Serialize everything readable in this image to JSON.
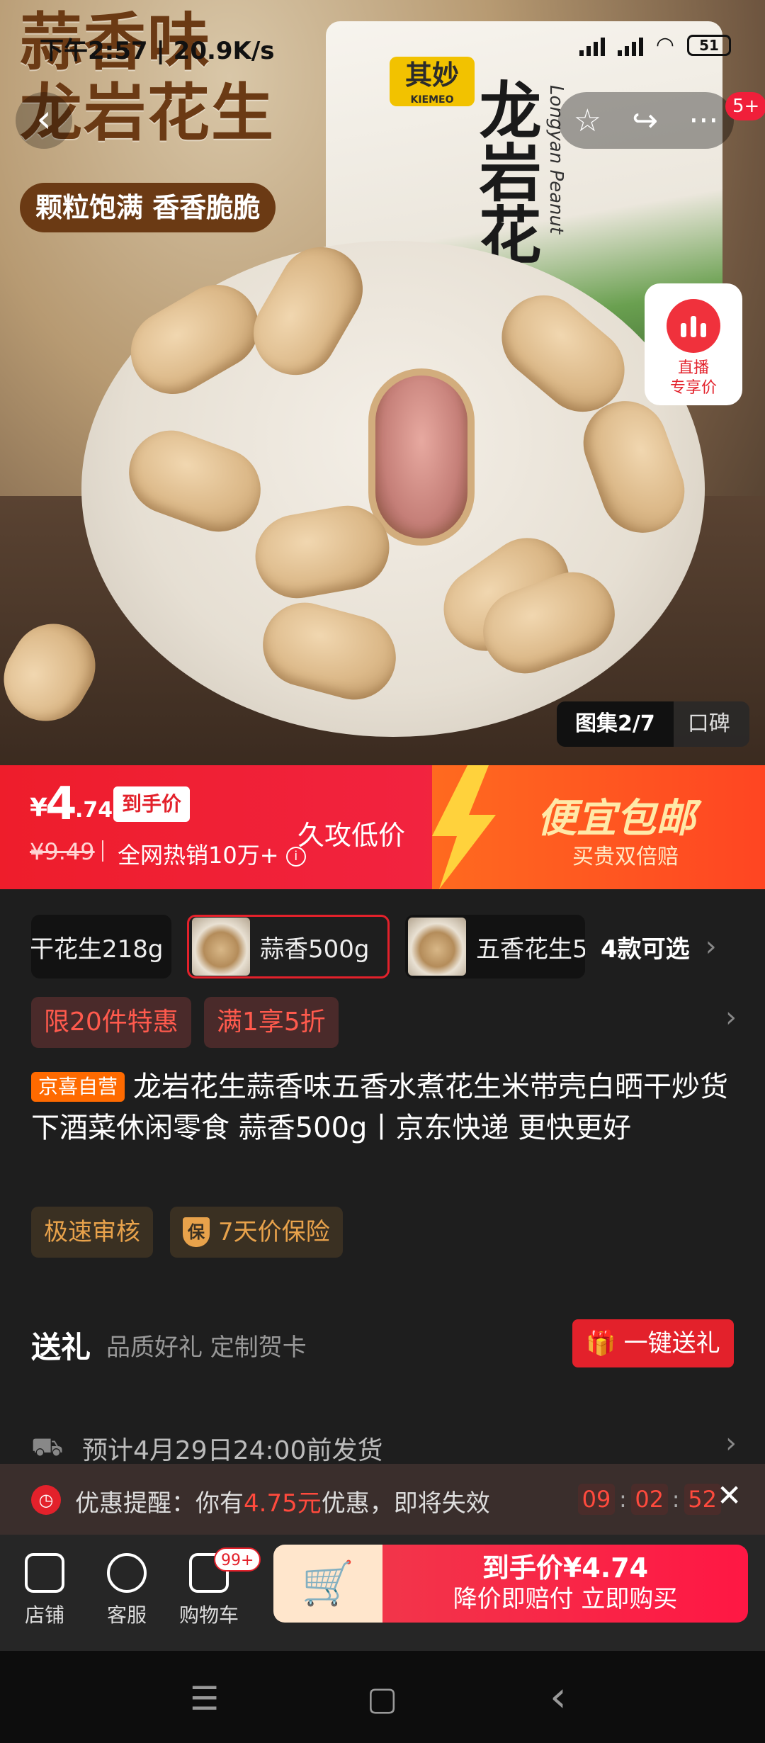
{
  "status_bar": {
    "time": "下午2:57 | 20.9K/s",
    "battery": "51"
  },
  "hero": {
    "headline_1": "蒜香味",
    "headline_2": "龙岩花生",
    "pill": "颗粒饱满 香香脆脆",
    "bag_brand": "其妙",
    "bag_brand_en": "KIEMEO",
    "bag_title": "龙岩花生",
    "bag_sub": "Longyan Peanut",
    "gallery_active": "图集2/7",
    "gallery_other": "口碑"
  },
  "topbar": {
    "back": "‹",
    "star": "☆",
    "share": "↪",
    "more": "···",
    "badge": "5+"
  },
  "live": {
    "line1": "直播",
    "line2": "专享价"
  },
  "price": {
    "yen": "¥",
    "int": "4",
    "dec": ".74",
    "tag": "到手价",
    "old": "¥9.49",
    "hot": "全网热销10万+",
    "info": "i",
    "slogan": "久攻低价",
    "big": "便宜包邮",
    "small": "买贵双倍赔"
  },
  "variants": {
    "items": [
      {
        "label": "干花生218g"
      },
      {
        "label": "蒜香500g"
      },
      {
        "label": "五香花生5"
      }
    ],
    "more": "4款可选"
  },
  "promos": [
    "限20件特惠",
    "满1享5折"
  ],
  "title": {
    "tag": "京喜自营",
    "text": "龙岩花生蒜香味五香水煮花生米带壳白晒干炒货下酒菜休闲零食 蒜香500g丨京东快递 更快更好"
  },
  "chips": {
    "a": "极速审核",
    "shield": "保",
    "b": "7天价保险"
  },
  "gift": {
    "heading": "送礼",
    "sub": "品质好礼 定制贺卡",
    "button": "一键送礼"
  },
  "shipping": {
    "text": "预计4月29日24:00前发货"
  },
  "notice": {
    "prefix": "优惠提醒：你有",
    "amount": "4.75元",
    "suffix": "优惠，即将失效",
    "h": "09",
    "m": "02",
    "s": "52",
    "close": "✕"
  },
  "bottom_nav": {
    "shop": "店铺",
    "service": "客服",
    "cart": "购物车",
    "cart_badge": "99+",
    "cta_line1": "到手价¥4.74",
    "cta_line2": "降价即赔付 立即购买"
  },
  "sysnav": {
    "menu": "☰",
    "home": "▢",
    "back": "‹"
  }
}
